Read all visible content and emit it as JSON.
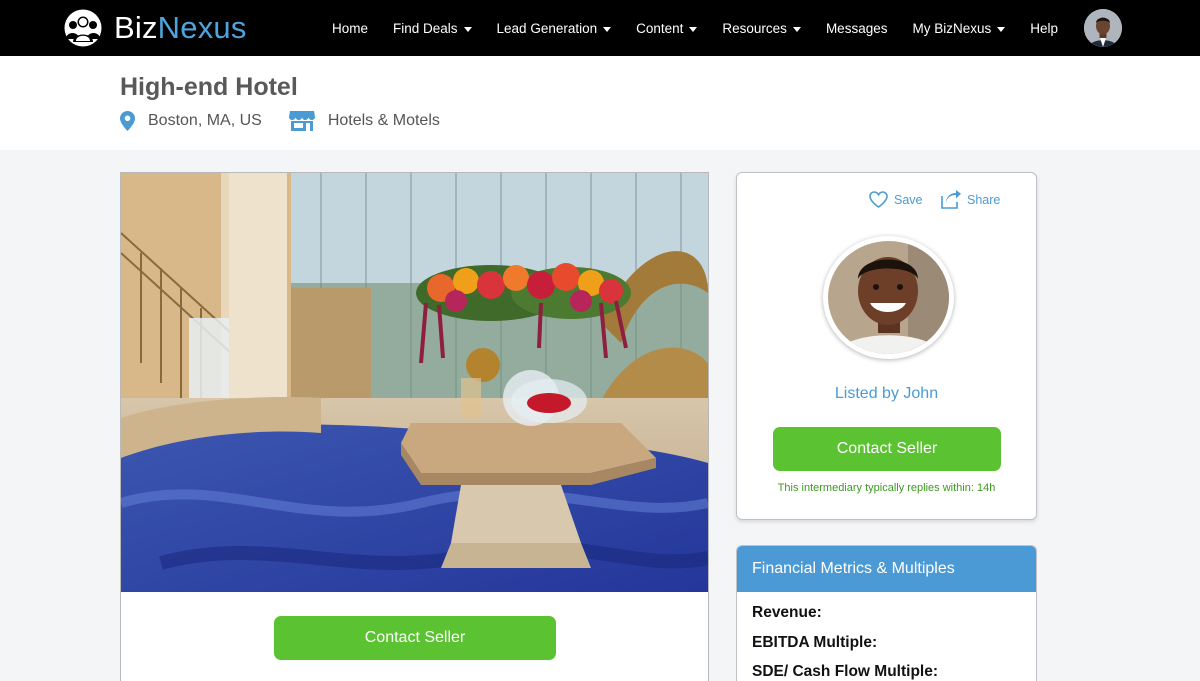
{
  "brand": {
    "name_a": "Biz",
    "name_b": "Nexus",
    "logo_icon": "people-group-icon"
  },
  "nav": {
    "items": [
      {
        "label": "Home",
        "dropdown": false
      },
      {
        "label": "Find Deals",
        "dropdown": true
      },
      {
        "label": "Lead Generation",
        "dropdown": true
      },
      {
        "label": "Content",
        "dropdown": true
      },
      {
        "label": "Resources",
        "dropdown": true
      },
      {
        "label": "Messages",
        "dropdown": false
      },
      {
        "label": "My BizNexus",
        "dropdown": true
      },
      {
        "label": "Help",
        "dropdown": false
      }
    ]
  },
  "listing": {
    "title": "High-end Hotel",
    "location": "Boston, MA, US",
    "category": "Hotels & Motels",
    "contact_label": "Contact Seller"
  },
  "seller": {
    "save_label": "Save",
    "share_label": "Share",
    "listed_by": "Listed by John",
    "contact_label": "Contact Seller",
    "reply_note": "This intermediary typically replies within: 14h"
  },
  "financials": {
    "header": "Financial Metrics & Multiples",
    "rows": [
      "Revenue:",
      "EBITDA Multiple:",
      "SDE/ Cash Flow Multiple:"
    ]
  },
  "colors": {
    "accent_blue": "#4a9bd4",
    "header_blue": "#4b9ad6",
    "button_green": "#5bc232",
    "note_green": "#3c9a1f",
    "topbar": "#000000"
  }
}
